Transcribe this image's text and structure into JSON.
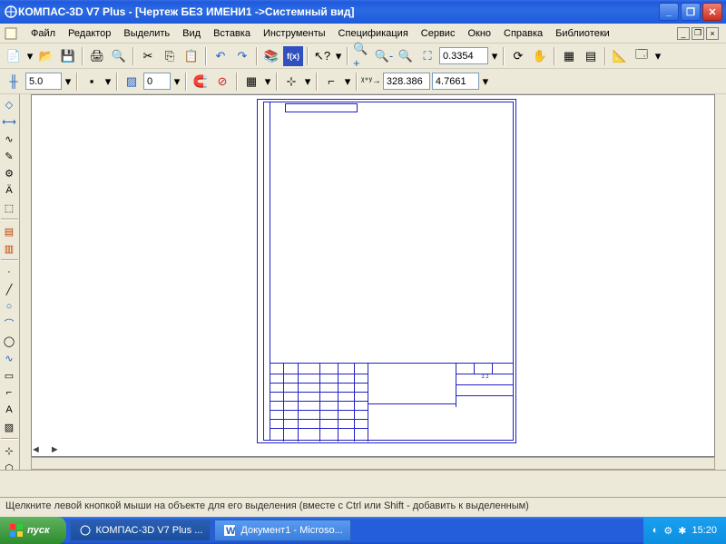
{
  "title": "КОМПАС-3D V7 Plus - [Чертеж БЕЗ ИМЕНИ1 ->Системный вид]",
  "menu": {
    "file": "Файл",
    "edit": "Редактор",
    "select": "Выделить",
    "view": "Вид",
    "insert": "Вставка",
    "tools": "Инструменты",
    "spec": "Спецификация",
    "service": "Сервис",
    "window": "Окно",
    "help": "Справка",
    "libs": "Библиотеки"
  },
  "tb2": {
    "zoom": "0.3354"
  },
  "tb3": {
    "val1": "5.0",
    "val2": "0",
    "x": "328.386",
    "y": "4.7661"
  },
  "status": "Щелкните левой кнопкой мыши на объекте для его выделения (вместе с Ctrl или Shift - добавить к выделенным)",
  "paging": {
    "prev": "◄",
    "next": "►"
  },
  "start": "пуск",
  "task1": "КОМПАС-3D V7 Plus ...",
  "task2": "Документ1 - Microso...",
  "clock": "15:20"
}
